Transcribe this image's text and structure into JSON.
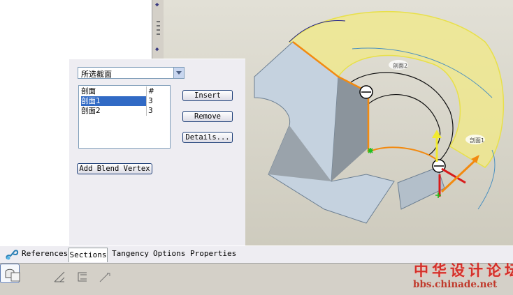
{
  "sections_panel": {
    "section_set_select": "所选截面",
    "list": {
      "headers": [
        "剖面",
        "#"
      ],
      "rows": [
        {
          "name": "剖面1",
          "count": "3"
        },
        {
          "name": "剖面2",
          "count": "3"
        }
      ]
    },
    "insert_label": "Insert",
    "remove_label": "Remove",
    "details_label": "Details...",
    "add_blend_vertex_label": "Add Blend Vertex"
  },
  "tabs": [
    "References",
    "Sections",
    "Tangency",
    "Options",
    "Properties"
  ],
  "active_tab": "Sections",
  "viewport": {
    "label_1": "剖面2",
    "label_2": "剖面1"
  },
  "dashboard_tools": [
    "surface-icon",
    "blend-section-icon",
    "thicken-icon",
    "trim-icon",
    "transition-icon"
  ],
  "watermark": {
    "chinese": "中华设计论坛",
    "url": "bbs.chinade.net"
  },
  "colors": {
    "selection": "#316ac5",
    "surface_yellow": "#f1ea86",
    "highlight_orange": "#f28a10",
    "watermark_red": "#d3302a"
  }
}
